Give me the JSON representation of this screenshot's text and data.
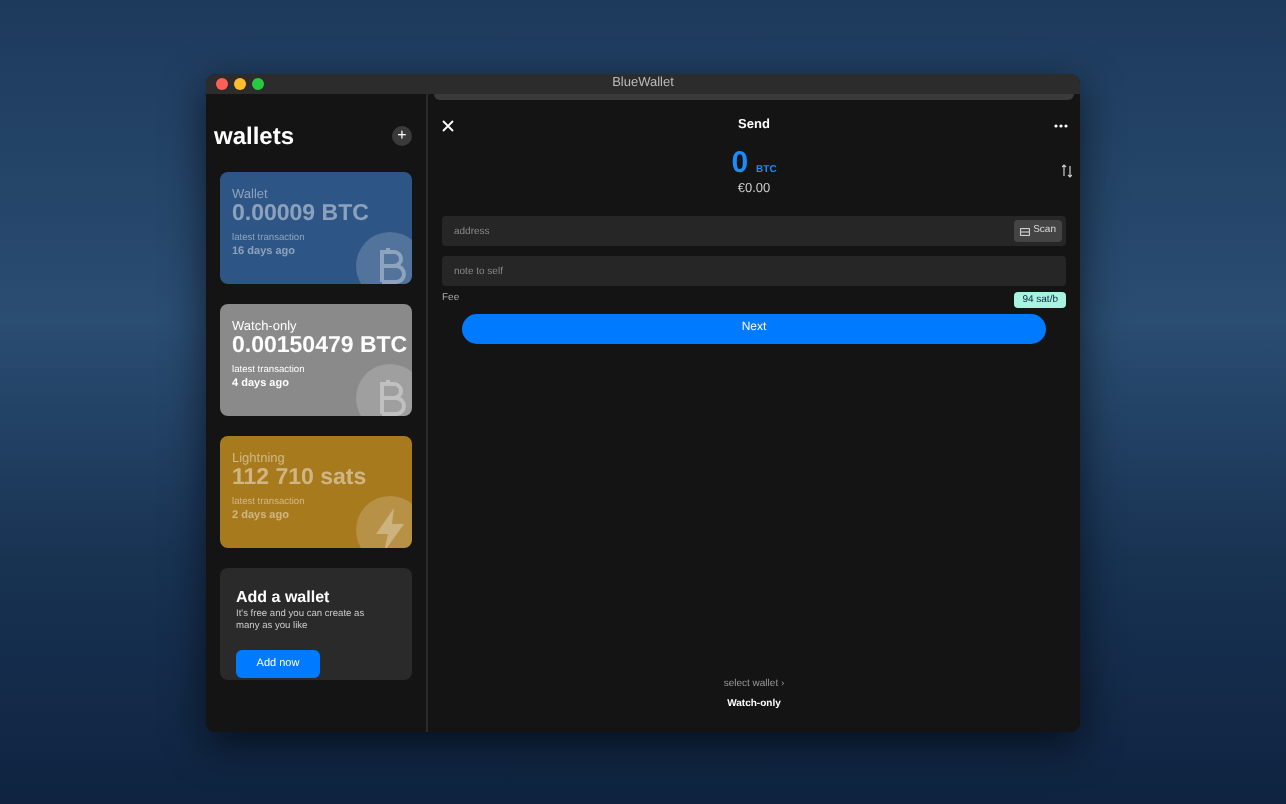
{
  "window": {
    "title": "BlueWallet"
  },
  "sidebar": {
    "title": "wallets",
    "add_button": "+",
    "wallets": [
      {
        "label": "Wallet",
        "balance": "0.00009 BTC",
        "latest_label": "latest transaction",
        "latest": "16 days ago",
        "kind": "bitcoin",
        "color": "#2d5585",
        "selected": false
      },
      {
        "label": "Watch-only",
        "balance": "0.00150479 BTC",
        "latest_label": "latest transaction",
        "latest": "4 days ago",
        "kind": "bitcoin",
        "color": "#8a8a8a",
        "selected": true
      },
      {
        "label": "Lightning",
        "balance": "112 710 sats",
        "latest_label": "latest transaction",
        "latest": "2 days ago",
        "kind": "lightning",
        "color": "#a87a1e",
        "selected": false
      }
    ],
    "add_card": {
      "title": "Add a wallet",
      "text": "It's free and you can create as many as you like",
      "button": "Add now"
    }
  },
  "send": {
    "title": "Send",
    "amount": "0",
    "unit": "BTC",
    "fiat": "€0.00",
    "address": {
      "placeholder": "address"
    },
    "scan_button": "Scan",
    "note": {
      "placeholder": "note to self"
    },
    "fee_label": "Fee",
    "fee": "94 sat/b",
    "next_button": "Next",
    "select_wallet": "select wallet ›",
    "selected_wallet": "Watch-only"
  }
}
